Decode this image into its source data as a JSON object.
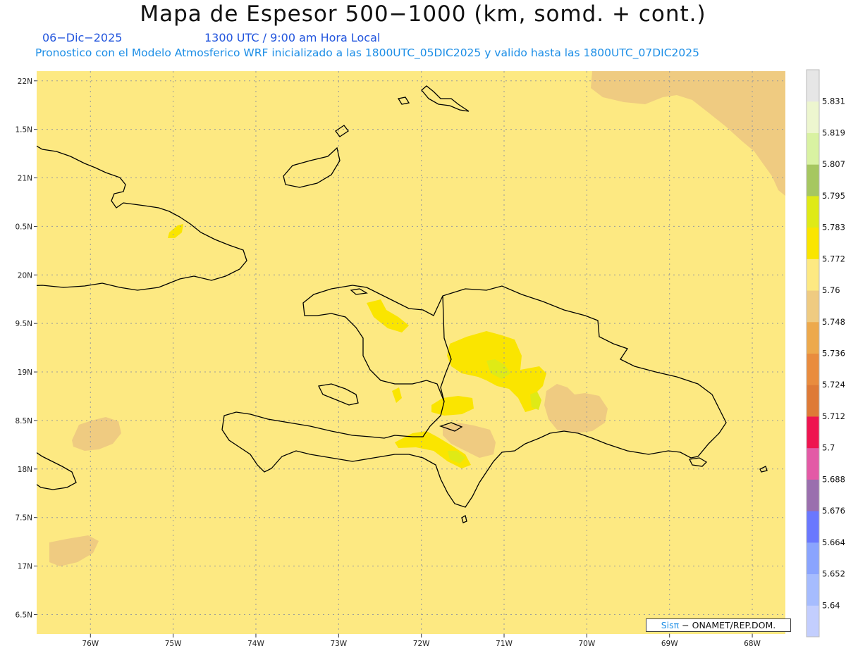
{
  "header": {
    "title": "Mapa de Espesor 500−1000 (km, somd. + cont.)",
    "date": "06−Dic−2025",
    "time": "1300 UTC / 9:00 am Hora Local",
    "forecast_line": "Pronostico con el Modelo Atmosferico WRF inicializado a las 1800UTC_05DIC2025 y valido hasta las  1800UTC_07DIC2025"
  },
  "map": {
    "extent": {
      "lon_min": -76.65,
      "lon_max": -67.6,
      "lat_min": 16.3,
      "lat_max": 22.1
    },
    "lat_ticks": [
      {
        "lat": 22.0,
        "label": "22N"
      },
      {
        "lat": 21.5,
        "label": "1.5N"
      },
      {
        "lat": 21.0,
        "label": "21N"
      },
      {
        "lat": 20.5,
        "label": "0.5N"
      },
      {
        "lat": 20.0,
        "label": "20N"
      },
      {
        "lat": 19.5,
        "label": "9.5N"
      },
      {
        "lat": 19.0,
        "label": "19N"
      },
      {
        "lat": 18.5,
        "label": "8.5N"
      },
      {
        "lat": 18.0,
        "label": "18N"
      },
      {
        "lat": 17.5,
        "label": "7.5N"
      },
      {
        "lat": 17.0,
        "label": "17N"
      },
      {
        "lat": 16.5,
        "label": "6.5N"
      }
    ],
    "lon_ticks": [
      {
        "lon": -76,
        "label": "76W"
      },
      {
        "lon": -75,
        "label": "75W"
      },
      {
        "lon": -74,
        "label": "74W"
      },
      {
        "lon": -73,
        "label": "73W"
      },
      {
        "lon": -72,
        "label": "72W"
      },
      {
        "lon": -71,
        "label": "71W"
      },
      {
        "lon": -70,
        "label": "70W"
      },
      {
        "lon": -69,
        "label": "69W"
      },
      {
        "lon": -68,
        "label": "68W"
      }
    ],
    "grid": true,
    "background_color": "#fde982",
    "coastline_color": "#000000"
  },
  "colorbar": {
    "location": "right",
    "colors": [
      "#c3cefe",
      "#a6bcfe",
      "#8aa4fe",
      "#6a78fe",
      "#9a6fae",
      "#e35aa6",
      "#ee1450",
      "#de7a37",
      "#e98c3e",
      "#eda94c",
      "#efcb81",
      "#fde982",
      "#fae500",
      "#dfea16",
      "#a6c760",
      "#d9f2a2",
      "#edf6cf",
      "#e6e6e6"
    ],
    "labels": [
      "5.64",
      "5.652",
      "5.664",
      "5.676",
      "5.688",
      "5.7",
      "5.712",
      "5.724",
      "5.736",
      "5.748",
      "5.76",
      "5.772",
      "5.783",
      "5.795",
      "5.807",
      "5.819",
      "5.831"
    ]
  },
  "credit": {
    "brand": "Sisπ",
    "text": "− ONAMET/REP.DOM."
  }
}
